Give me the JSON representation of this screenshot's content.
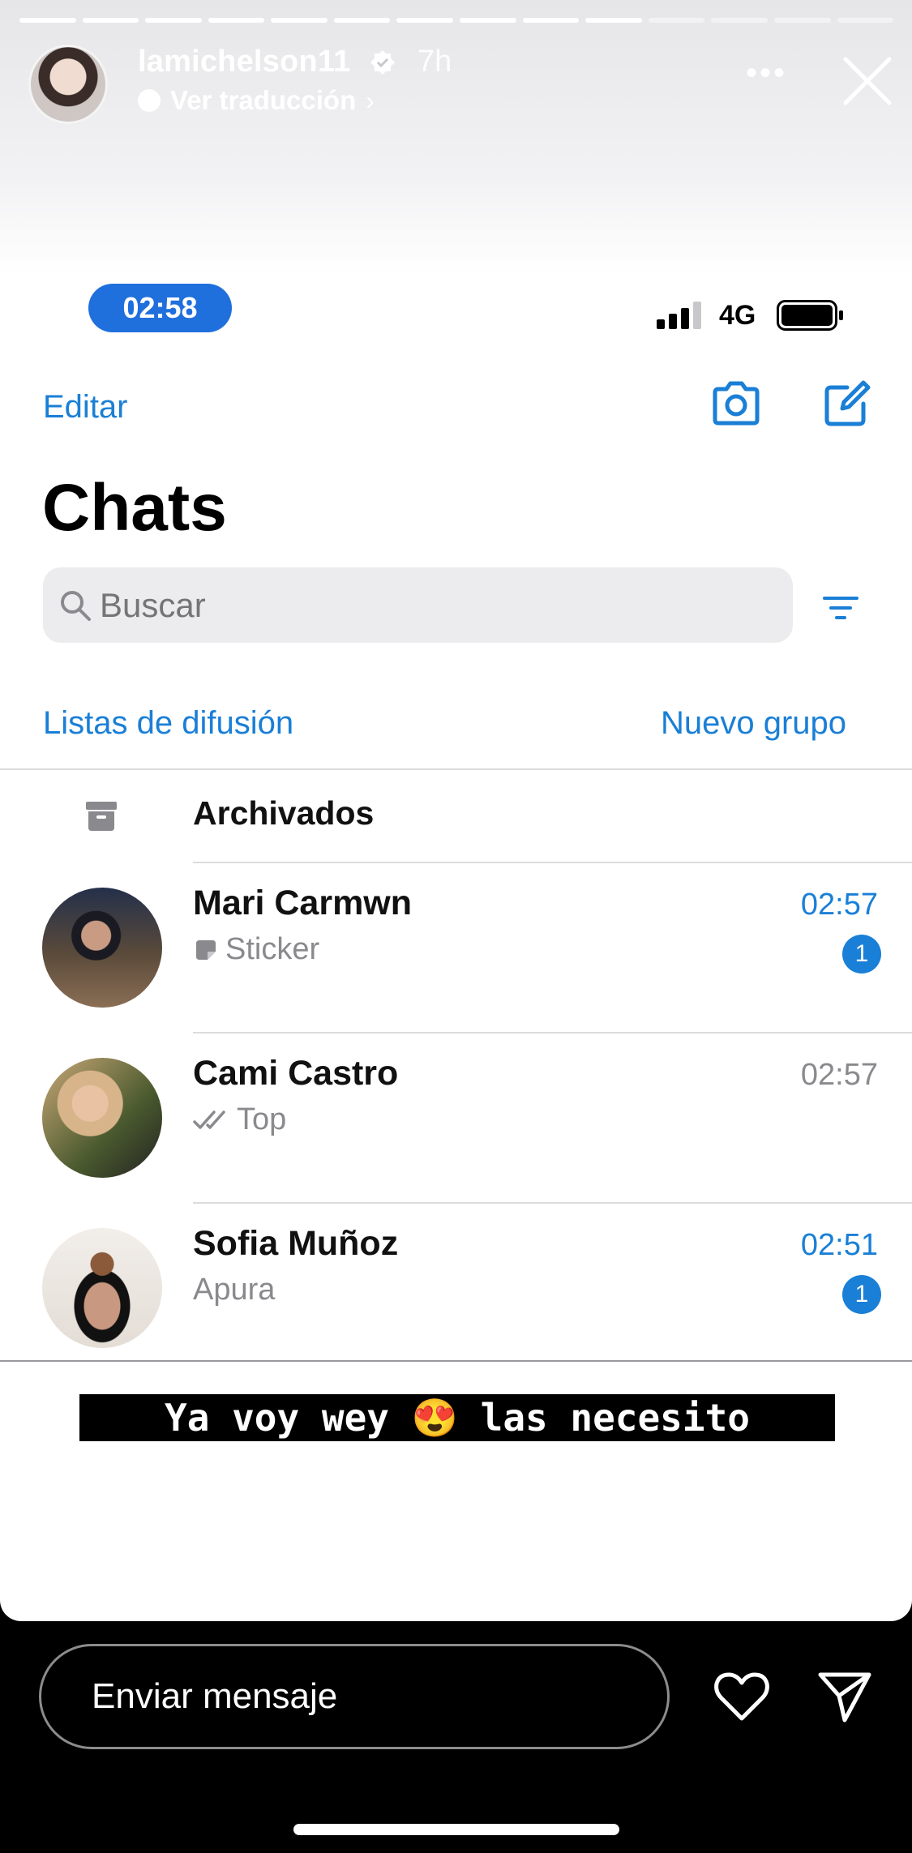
{
  "story": {
    "username": "lamichelson11",
    "time_ago": "7h",
    "translate_label": "Ver traducción",
    "progress_segments": 14,
    "progress_done": 10,
    "caption": "Ya voy wey 😍 las necesito"
  },
  "phone": {
    "clock": "02:58",
    "network": "4G"
  },
  "whatsapp": {
    "edit_label": "Editar",
    "title": "Chats",
    "search_placeholder": "Buscar",
    "broadcast_label": "Listas de difusión",
    "new_group_label": "Nuevo grupo",
    "archived_label": "Archivados",
    "chats": [
      {
        "name": "Mari Carmwn",
        "preview": "Sticker",
        "time": "02:57",
        "unread": "1",
        "preview_icon": "sticker-icon"
      },
      {
        "name": "Cami Castro",
        "preview": "Top",
        "time": "02:57",
        "unread": "",
        "preview_icon": "double-check-icon"
      },
      {
        "name": "Sofia Muñoz",
        "preview": "Apura",
        "time": "02:51",
        "unread": "1",
        "preview_icon": ""
      }
    ]
  },
  "reply": {
    "placeholder": "Enviar mensaje"
  },
  "colors": {
    "accent": "#1a7fd6",
    "clock_pill": "#1f6fdc"
  }
}
